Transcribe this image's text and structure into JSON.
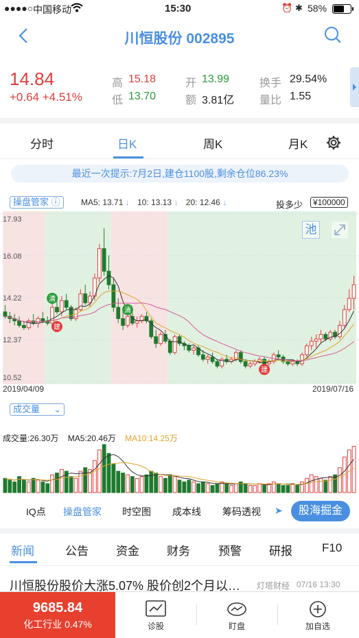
{
  "status_bar": {
    "carrier": "中国移动",
    "time": "15:30",
    "battery": "58%"
  },
  "header": {
    "stock_name": "川恒股份",
    "stock_code": "002895"
  },
  "quote": {
    "price": "14.84",
    "change": "+0.64",
    "change_pct": "+4.51%",
    "high_label": "高",
    "high": "15.18",
    "low_label": "低",
    "low": "13.70",
    "open_label": "开",
    "open": "13.99",
    "amount_label": "额",
    "amount": "3.81亿",
    "turnover_label": "换手",
    "turnover": "29.54%",
    "vol_ratio_label": "量比",
    "vol_ratio": "1.55"
  },
  "kline_tabs": [
    "分时",
    "日K",
    "周K",
    "月K"
  ],
  "active_kline_tab": "日K",
  "tip": "最近一次提示:7月2日,建仓1100股,剩余仓位86.23%",
  "chart_bar": {
    "manager_label": "操盘管家",
    "ma5": "MA5: 13.71",
    "ma10": "10: 13.13",
    "ma20": "20: 12.46",
    "invest_label": "投多少",
    "invest_amount": "¥100000",
    "pool_label": "池"
  },
  "volume_header": {
    "selector": "成交量",
    "vol": "成交量:26.30万",
    "ma5": "MA5:20.46万",
    "ma10": "MA10:14.25万"
  },
  "tools": [
    "IQ点",
    "操盘管家",
    "时空图",
    "成本线",
    "筹码透视"
  ],
  "tools_cta": "股海掘金",
  "news_tabs": [
    "新闻",
    "公告",
    "资金",
    "财务",
    "预警",
    "研报",
    "F10"
  ],
  "active_news_tab": "新闻",
  "news_item": {
    "title": "川恒股份股价大涨5.07% 股价创2个月以…",
    "source": "灯塔财经",
    "time": "07/16 13:30"
  },
  "footer": {
    "index_value": "9685.84",
    "index_name": "化工行业",
    "index_change": "0.47%",
    "btn_diagnose": "诊股",
    "btn_watch": "盯盘",
    "btn_add": "加自选"
  },
  "chart_data": {
    "type": "candlestick",
    "x_start": "2019/04/09",
    "x_end": "2019/07/16",
    "ytick_labels": [
      "17.93",
      "16.08",
      "14.22",
      "12.37",
      "10.52"
    ],
    "ylim": [
      10.52,
      17.93
    ],
    "signals": [
      {
        "label": "清"
      },
      {
        "label": "建"
      },
      {
        "label": "清"
      },
      {
        "label": "建"
      }
    ],
    "candles": [
      [
        13.6,
        13.9,
        13.3,
        13.4
      ],
      [
        13.4,
        13.6,
        13.1,
        13.3
      ],
      [
        13.3,
        13.5,
        13.0,
        13.2
      ],
      [
        13.2,
        13.4,
        12.9,
        13.0
      ],
      [
        13.0,
        13.2,
        12.8,
        12.9
      ],
      [
        12.9,
        13.3,
        12.8,
        13.2
      ],
      [
        13.2,
        13.5,
        13.0,
        13.1
      ],
      [
        13.1,
        13.4,
        12.9,
        13.3
      ],
      [
        13.3,
        13.6,
        13.1,
        13.2
      ],
      [
        13.2,
        13.4,
        13.0,
        13.1
      ],
      [
        13.1,
        14.0,
        13.0,
        13.8
      ],
      [
        13.8,
        14.2,
        13.5,
        13.6
      ],
      [
        13.6,
        14.3,
        13.4,
        14.1
      ],
      [
        14.1,
        14.4,
        13.7,
        13.8
      ],
      [
        13.8,
        13.9,
        13.2,
        13.3
      ],
      [
        13.3,
        13.8,
        13.2,
        13.7
      ],
      [
        13.7,
        14.6,
        13.6,
        14.4
      ],
      [
        14.4,
        14.8,
        13.9,
        14.0
      ],
      [
        14.0,
        14.5,
        13.8,
        14.3
      ],
      [
        14.3,
        15.3,
        14.1,
        15.1
      ],
      [
        15.1,
        16.6,
        14.9,
        16.4
      ],
      [
        16.4,
        17.3,
        15.2,
        15.4
      ],
      [
        15.4,
        16.1,
        14.6,
        14.8
      ],
      [
        14.8,
        15.1,
        13.6,
        13.8
      ],
      [
        13.8,
        14.2,
        13.1,
        13.3
      ],
      [
        13.3,
        13.6,
        12.8,
        13.0
      ],
      [
        13.0,
        13.5,
        12.9,
        13.4
      ],
      [
        13.4,
        13.6,
        13.0,
        13.1
      ],
      [
        13.1,
        13.4,
        12.9,
        13.2
      ],
      [
        13.2,
        13.5,
        13.1,
        13.4
      ],
      [
        13.4,
        13.6,
        13.1,
        13.2
      ],
      [
        13.2,
        13.3,
        12.4,
        12.5
      ],
      [
        12.5,
        12.8,
        12.0,
        12.2
      ],
      [
        12.2,
        12.7,
        12.1,
        12.6
      ],
      [
        12.6,
        12.8,
        12.2,
        12.3
      ],
      [
        12.3,
        12.4,
        11.7,
        11.8
      ],
      [
        11.8,
        12.6,
        11.7,
        12.5
      ],
      [
        12.5,
        12.6,
        12.1,
        12.2
      ],
      [
        12.2,
        12.3,
        11.9,
        12.1
      ],
      [
        12.1,
        12.2,
        11.8,
        11.9
      ],
      [
        11.9,
        12.1,
        11.7,
        12.0
      ],
      [
        12.0,
        12.1,
        11.6,
        11.7
      ],
      [
        11.7,
        11.9,
        11.4,
        11.5
      ],
      [
        11.5,
        11.7,
        11.3,
        11.6
      ],
      [
        11.6,
        11.8,
        11.3,
        11.4
      ],
      [
        11.4,
        11.5,
        11.1,
        11.2
      ],
      [
        11.2,
        11.6,
        11.1,
        11.5
      ],
      [
        11.5,
        11.7,
        11.3,
        11.4
      ],
      [
        11.4,
        11.6,
        11.3,
        11.5
      ],
      [
        11.5,
        11.9,
        11.4,
        11.8
      ],
      [
        11.8,
        11.9,
        11.3,
        11.4
      ],
      [
        11.4,
        11.5,
        11.1,
        11.2
      ],
      [
        11.2,
        11.4,
        11.1,
        11.3
      ],
      [
        11.3,
        11.5,
        11.2,
        11.4
      ],
      [
        11.4,
        11.6,
        11.3,
        11.5
      ],
      [
        11.5,
        11.6,
        11.2,
        11.3
      ],
      [
        11.3,
        11.5,
        11.2,
        11.4
      ],
      [
        11.4,
        11.8,
        11.3,
        11.7
      ],
      [
        11.7,
        11.9,
        11.5,
        11.6
      ],
      [
        11.6,
        11.7,
        11.3,
        11.4
      ],
      [
        11.4,
        11.5,
        11.2,
        11.3
      ],
      [
        11.3,
        11.5,
        11.2,
        11.4
      ],
      [
        11.4,
        11.5,
        11.2,
        11.3
      ],
      [
        11.3,
        11.8,
        11.2,
        11.7
      ],
      [
        11.7,
        12.2,
        11.6,
        12.1
      ],
      [
        12.1,
        12.5,
        11.9,
        12.3
      ],
      [
        12.3,
        12.6,
        12.0,
        12.4
      ],
      [
        12.4,
        12.8,
        12.2,
        12.6
      ],
      [
        12.6,
        12.7,
        12.3,
        12.4
      ],
      [
        12.4,
        12.8,
        12.3,
        12.7
      ],
      [
        12.7,
        12.8,
        12.4,
        12.5
      ],
      [
        12.5,
        13.2,
        12.4,
        13.0
      ],
      [
        13.0,
        13.9,
        12.9,
        13.7
      ],
      [
        13.7,
        14.6,
        13.6,
        14.2
      ],
      [
        14.2,
        15.2,
        13.7,
        14.8
      ]
    ],
    "volume": [
      8,
      7,
      6,
      9,
      7,
      6,
      8,
      7,
      6,
      5,
      10,
      11,
      13,
      12,
      9,
      8,
      12,
      14,
      13,
      18,
      24,
      27,
      22,
      16,
      12,
      11,
      10,
      9,
      8,
      9,
      10,
      12,
      11,
      9,
      8,
      10,
      9,
      7,
      6,
      7,
      6,
      5,
      6,
      5,
      4,
      5,
      6,
      5,
      4,
      5,
      6,
      5,
      4,
      4,
      5,
      4,
      5,
      6,
      5,
      4,
      4,
      5,
      4,
      6,
      8,
      10,
      9,
      8,
      7,
      9,
      10,
      14,
      20,
      24,
      26
    ]
  }
}
